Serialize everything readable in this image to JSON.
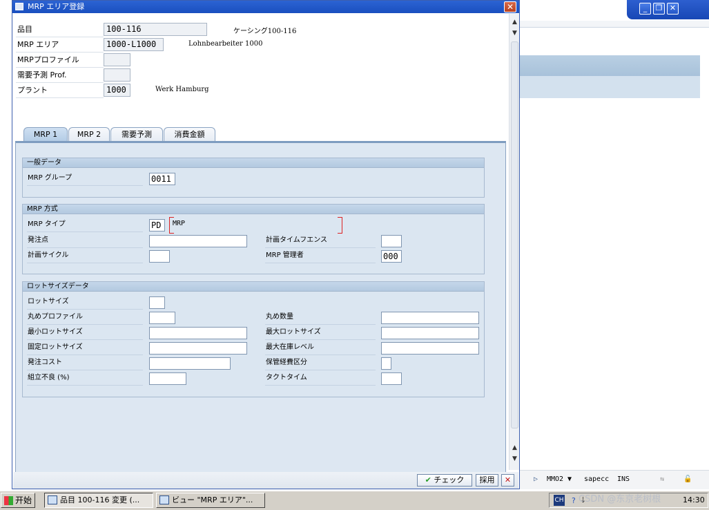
{
  "dialog": {
    "title": "MRP エリア登録",
    "close_label": "✕"
  },
  "header": {
    "material_label": "品目",
    "material_value": "100-116",
    "material_desc": "ケーシング100-116",
    "mrp_area_label": "MRP エリア",
    "mrp_area_value": "1000-L1000",
    "mrp_area_desc": "Lohnbearbeiter 1000",
    "mrp_profile_label": "MRPプロファイル",
    "mrp_profile_value": "",
    "forecast_prof_label": "需要予測 Prof.",
    "forecast_prof_value": "",
    "plant_label": "プラント",
    "plant_value": "1000",
    "plant_desc": "Werk Hamburg"
  },
  "tabs": [
    "MRP 1",
    "MRP 2",
    "需要予測",
    "消費金額"
  ],
  "active_tab": "MRP 1",
  "general": {
    "title": "一般データ",
    "mrp_group_label": "MRP グループ",
    "mrp_group_value": "0011"
  },
  "procedure": {
    "title": "MRP 方式",
    "mrp_type_label": "MRP タイプ",
    "mrp_type_value": "PD",
    "mrp_type_desc": "MRP",
    "reorder_point_label": "発注点",
    "reorder_point_value": "",
    "time_fence_label": "計画タイムフエンス",
    "time_fence_value": "",
    "planning_cycle_label": "計画サイクル",
    "planning_cycle_value": "",
    "controller_label": "MRP 管理者",
    "controller_value": "000"
  },
  "lotsize": {
    "title": "ロットサイズデータ",
    "lot_size_label": "ロットサイズ",
    "lot_size_value": "",
    "rounding_profile_label": "丸めプロファイル",
    "rounding_profile_value": "",
    "rounding_value_label": "丸め数量",
    "rounding_value_value": "",
    "min_lot_label": "最小ロットサイズ",
    "min_lot_value": "",
    "max_lot_label": "最大ロットサイズ",
    "max_lot_value": "",
    "fixed_lot_label": "固定ロットサイズ",
    "fixed_lot_value": "",
    "max_stock_label": "最大在庫レベル",
    "max_stock_value": "",
    "order_cost_label": "発注コスト",
    "order_cost_value": "",
    "storage_cost_label": "保管経費区分",
    "storage_cost_value": "",
    "assembly_scrap_label": "組立不良 (%)",
    "assembly_scrap_value": "",
    "takt_time_label": "タクトタイム",
    "takt_time_value": ""
  },
  "footer": {
    "check_label": "チェック",
    "adopt_label": "採用",
    "cancel_label": "✕"
  },
  "status": {
    "transaction": "MMO2",
    "server": "sapecc",
    "mode": "INS"
  },
  "taskbar": {
    "start_label": "开始",
    "task1_label": "品目 100-116 変更 (...",
    "task2_label": "ビュー \"MRP エリア\"...",
    "lang": "CH",
    "clock": "14:30",
    "watermark": "CSDN @东京老树根"
  },
  "colors": {
    "title_blue": "#1a4fbf",
    "panel_bg": "#dde7f2",
    "close_red": "#b8411f"
  }
}
